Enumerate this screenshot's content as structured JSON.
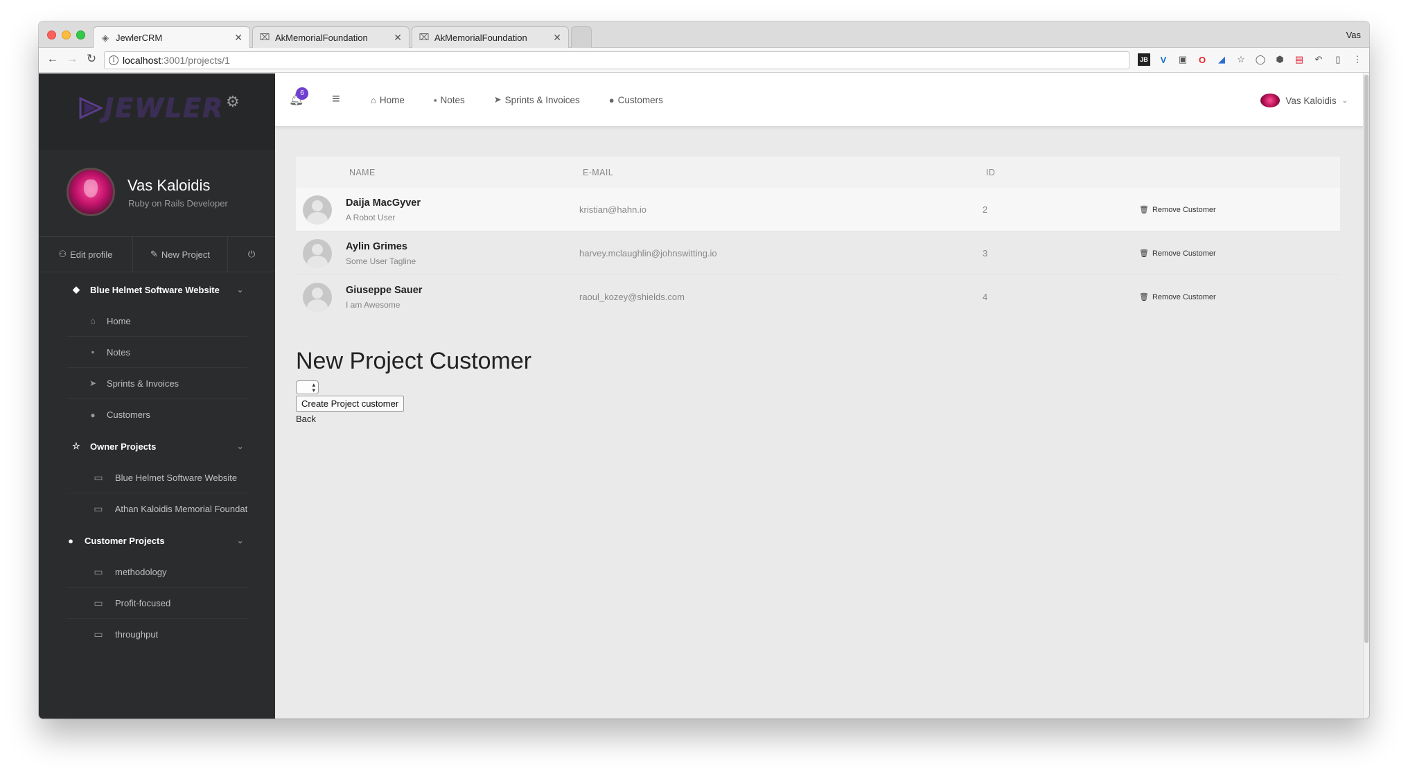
{
  "browser": {
    "tabs": [
      {
        "title": "JewlerCRM",
        "active": true
      },
      {
        "title": "AkMemorialFoundation",
        "active": false
      },
      {
        "title": "AkMemorialFoundation",
        "active": false
      }
    ],
    "window_user": "Vas",
    "url_host": "localhost",
    "url_path": ":3001/projects/1"
  },
  "sidebar": {
    "brand": "JEWLER",
    "profile": {
      "name": "Vas Kaloidis",
      "role": "Ruby on Rails Developer"
    },
    "actions": {
      "edit_profile": "Edit profile",
      "new_project": "New Project"
    },
    "groups": [
      {
        "label": "Blue Helmet Software Website",
        "icon": "diamond-icon",
        "items": [
          {
            "label": "Home",
            "icon": "home-icon"
          },
          {
            "label": "Notes",
            "icon": "notes-icon"
          },
          {
            "label": "Sprints & Invoices",
            "icon": "paper-plane-icon"
          },
          {
            "label": "Customers",
            "icon": "user-icon"
          }
        ]
      },
      {
        "label": "Owner Projects",
        "icon": "star-icon",
        "items": [
          {
            "label": "Blue Helmet Software Website",
            "icon": "monitor-icon"
          },
          {
            "label": "Athan Kaloidis Memorial Foundati",
            "icon": "monitor-icon"
          }
        ]
      },
      {
        "label": "Customer Projects",
        "icon": "user-icon",
        "items": [
          {
            "label": "methodology",
            "icon": "monitor-icon"
          },
          {
            "label": "Profit-focused",
            "icon": "monitor-icon"
          },
          {
            "label": "throughput",
            "icon": "monitor-icon"
          }
        ]
      }
    ]
  },
  "topbar": {
    "notification_count": "6",
    "nav": [
      {
        "label": "Home",
        "icon": "home-icon"
      },
      {
        "label": "Notes",
        "icon": "notes-icon"
      },
      {
        "label": "Sprints & Invoices",
        "icon": "paper-plane-icon"
      },
      {
        "label": "Customers",
        "icon": "user-icon"
      }
    ],
    "user_name": "Vas Kaloidis"
  },
  "customers_table": {
    "headers": {
      "name": "NAME",
      "email": "E-MAIL",
      "id": "ID"
    },
    "rows": [
      {
        "name": "Daija MacGyver",
        "tagline": "A Robot User",
        "email": "kristian@hahn.io",
        "id": "2",
        "action": "Remove Customer"
      },
      {
        "name": "Aylin Grimes",
        "tagline": "Some User Tagline",
        "email": "harvey.mclaughlin@johnswitting.io",
        "id": "3",
        "action": "Remove Customer"
      },
      {
        "name": "Giuseppe Sauer",
        "tagline": "I am Awesome",
        "email": "raoul_kozey@shields.com",
        "id": "4",
        "action": "Remove Customer"
      }
    ]
  },
  "form": {
    "title": "New Project Customer",
    "submit_label": "Create Project customer",
    "back_label": "Back"
  },
  "colors": {
    "sidebar_bg": "#2b2c2e",
    "main_bg": "#eaeaea",
    "badge": "#6f3fd1"
  }
}
